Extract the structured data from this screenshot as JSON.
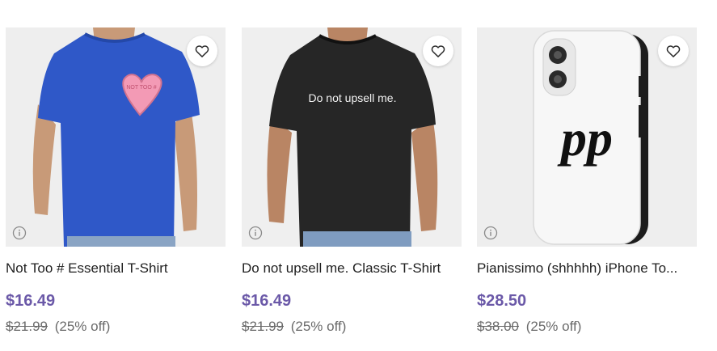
{
  "products": [
    {
      "title": "Not Too # Essential T-Shirt",
      "price": "$16.49",
      "original_price": "$21.99",
      "discount": "(25% off)",
      "image": "blue t-shirt with pink candy heart",
      "heart_text": "NOT TOO #"
    },
    {
      "title": "Do not upsell me. Classic T-Shirt",
      "price": "$16.49",
      "original_price": "$21.99",
      "discount": "(25% off)",
      "image": "black t-shirt with white text",
      "shirt_text": "Do not upsell me."
    },
    {
      "title": "Pianissimo (shhhhh) iPhone To...",
      "price": "$28.50",
      "original_price": "$38.00",
      "discount": "(25% off)",
      "image": "white phone case with pp marking",
      "case_text": "pp"
    }
  ],
  "icons": {
    "favorite": "heart-outline-icon",
    "info": "info-circle-icon"
  },
  "colors": {
    "price": "#6b59a8",
    "title": "#1f1f1f",
    "muted": "#6a6a6a",
    "image_bg": "#f2f2f2"
  }
}
